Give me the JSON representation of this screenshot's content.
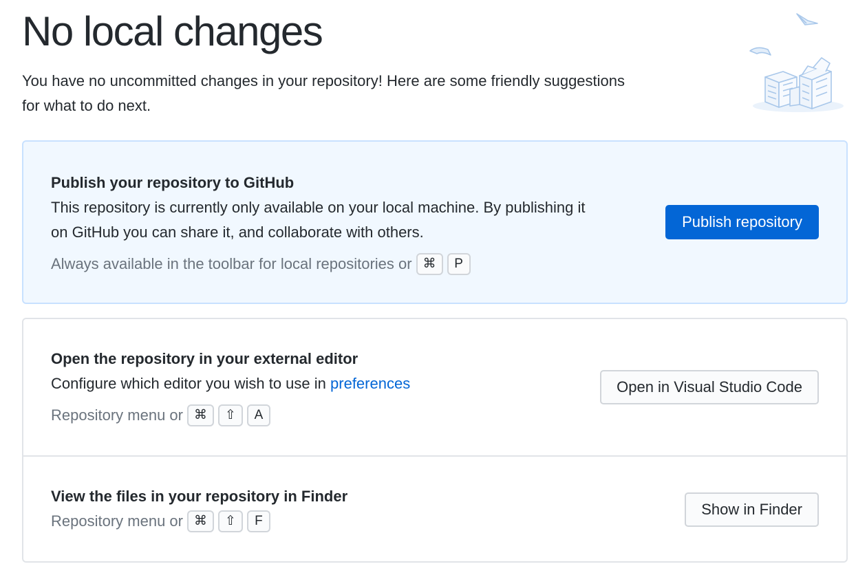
{
  "header": {
    "title": "No local changes",
    "subtitle": "You have no uncommitted changes in your repository! Here are some friendly suggestions for what to do next."
  },
  "publish": {
    "title": "Publish your repository to GitHub",
    "description": "This repository is currently only available on your local machine. By publishing it on GitHub you can share it, and collaborate with others.",
    "hint": "Always available in the toolbar for local repositories or",
    "keys": [
      "⌘",
      "P"
    ],
    "button_label": "Publish repository"
  },
  "editor": {
    "title": "Open the repository in your external editor",
    "description_prefix": "Configure which editor you wish to use in",
    "description_link": "preferences",
    "hint": "Repository menu or",
    "keys": [
      "⌘",
      "⇧",
      "A"
    ],
    "button_label": "Open in Visual Studio Code"
  },
  "finder": {
    "title": "View the files in your repository in Finder",
    "hint": "Repository menu or",
    "keys": [
      "⌘",
      "⇧",
      "F"
    ],
    "button_label": "Show in Finder"
  },
  "colors": {
    "accent": "#0366d6",
    "publish_background": "#f1f8ff",
    "publish_border": "#c8e1ff",
    "muted_text": "#6a737d"
  }
}
